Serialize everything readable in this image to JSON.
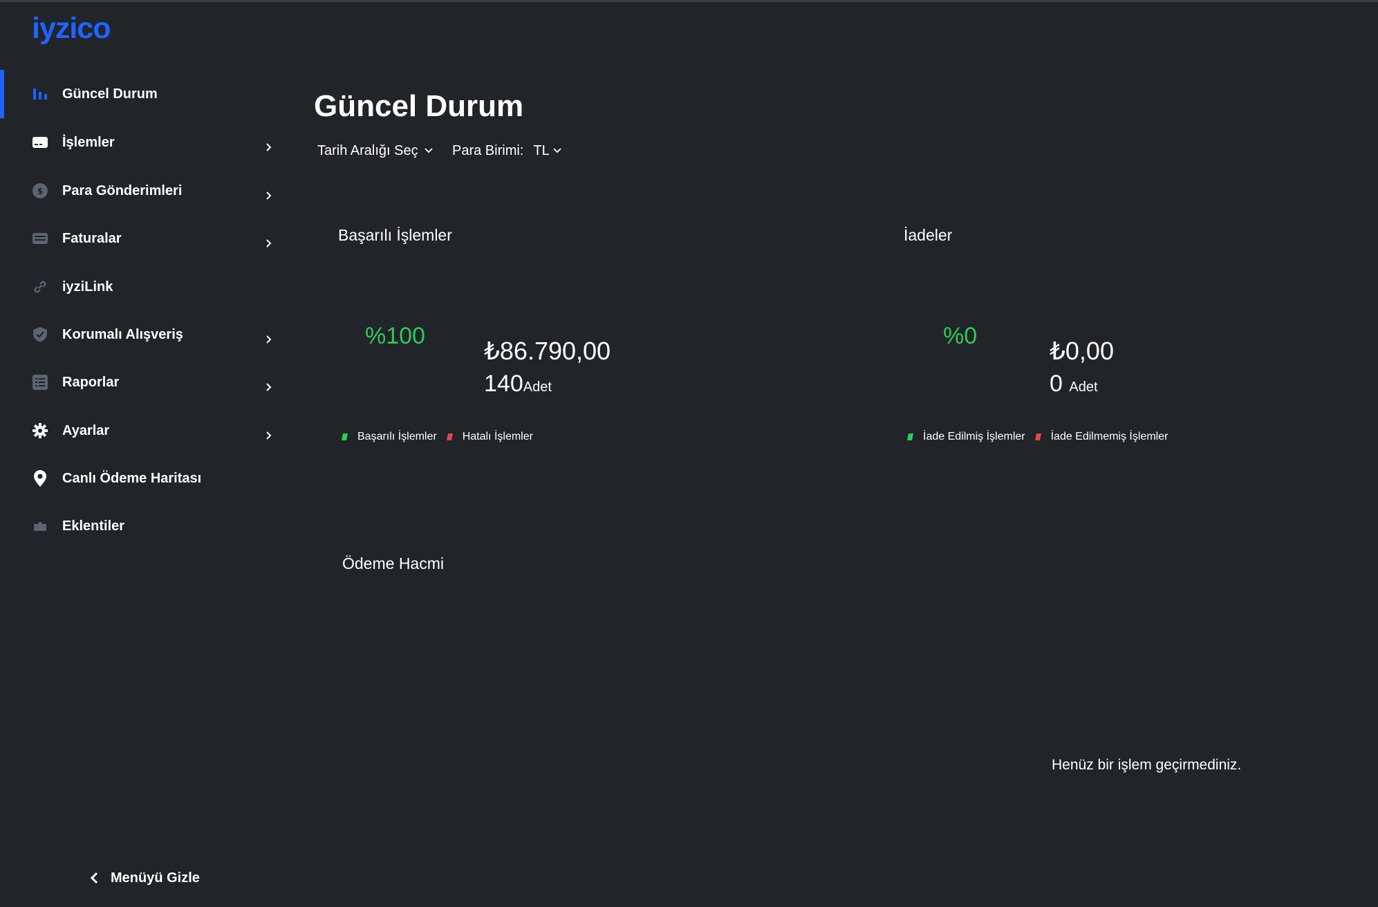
{
  "brand": {
    "logo": "iyzico",
    "accent": "#1e64ff",
    "success": "#2ecc54",
    "error": "#e04848"
  },
  "sidebar": {
    "items": [
      {
        "label": "Güncel Durum",
        "icon": "bar-chart-icon",
        "active": true,
        "has_children": false
      },
      {
        "label": "İşlemler",
        "icon": "credit-card-icon",
        "has_children": true
      },
      {
        "label": "Para Gönderimleri",
        "icon": "dollar-coin-icon",
        "has_children": true
      },
      {
        "label": "Faturalar",
        "icon": "invoice-icon",
        "has_children": true
      },
      {
        "label": "iyziLink",
        "icon": "link-icon",
        "has_children": false
      },
      {
        "label": "Korumalı Alışveriş",
        "icon": "shield-check-icon",
        "has_children": true
      },
      {
        "label": "Raporlar",
        "icon": "report-icon",
        "has_children": true
      },
      {
        "label": "Ayarlar",
        "icon": "gear-icon",
        "has_children": true
      },
      {
        "label": "Canlı Ödeme Haritası",
        "icon": "map-pin-icon",
        "has_children": false
      },
      {
        "label": "Eklentiler",
        "icon": "puzzle-icon",
        "has_children": false
      }
    ],
    "hide_menu_label": "Menüyü Gizle"
  },
  "main": {
    "title": "Güncel Durum",
    "filters": {
      "date_range_label": "Tarih Aralığı Seç",
      "currency_label": "Para Birimi:",
      "currency_value": "TL"
    },
    "successful": {
      "title": "Başarılı İşlemler",
      "percent": "%100",
      "amount": "₺86.790,00",
      "count": "140",
      "unit": "Adet",
      "legend": [
        "Başarılı İşlemler",
        "Hatalı İşlemler"
      ]
    },
    "refunds": {
      "title": "İadeler",
      "percent": "%0",
      "amount": "₺0,00",
      "count": "0",
      "unit": "Adet",
      "legend": [
        "İade Edilmiş İşlemler",
        "İade Edilmemiş İşlemler"
      ]
    },
    "volume": {
      "title": "Ödeme Hacmi",
      "empty_message": "Henüz bir işlem geçirmediniz."
    }
  }
}
